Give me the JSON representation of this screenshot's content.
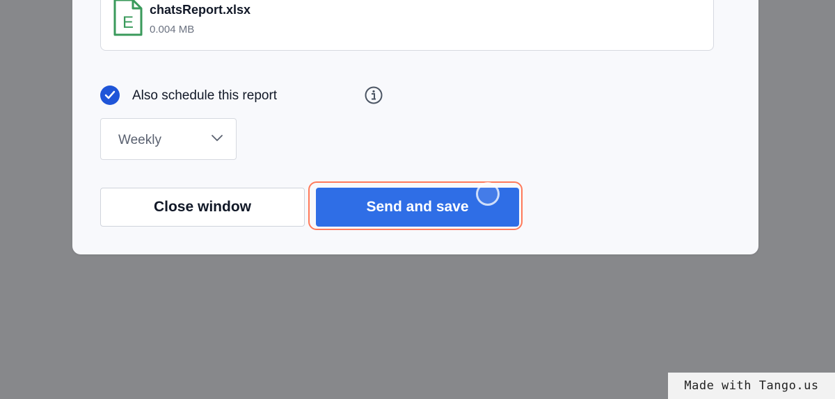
{
  "file": {
    "name": "chatsReport.xlsx",
    "size": "0.004 MB",
    "icon_letter": "E",
    "icon": "excel-file-icon"
  },
  "schedule": {
    "checked": true,
    "label": "Also schedule this report",
    "frequency": "Weekly"
  },
  "buttons": {
    "close_label": "Close window",
    "send_label": "Send and save"
  },
  "watermark": "Made with Tango.us",
  "colors": {
    "primary": "#2f6ee6",
    "checkbox": "#1f55d8",
    "file_icon": "#3a9a5b",
    "highlight": "#ff7a5a",
    "backdrop": "#87888b"
  }
}
